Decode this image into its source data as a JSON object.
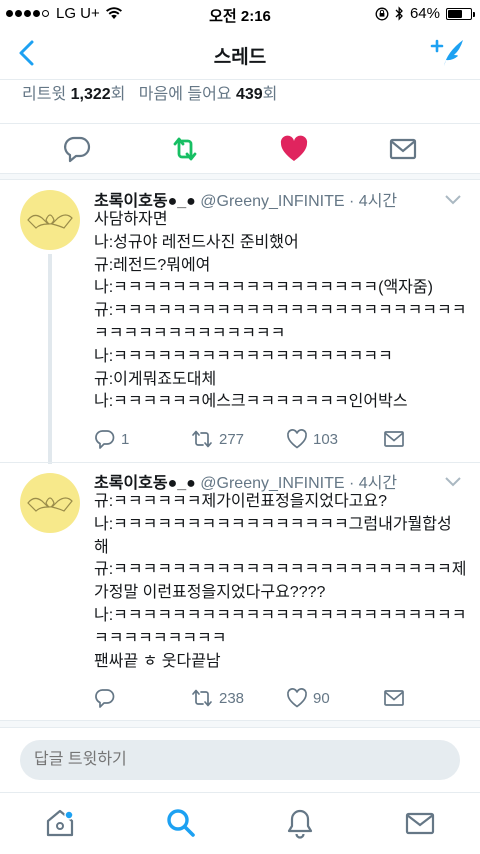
{
  "status_bar": {
    "carrier": "LG U+",
    "time": "오전 2:16",
    "battery": "64%",
    "battery_level": 0.64
  },
  "nav": {
    "title": "스레드"
  },
  "stats": {
    "retweets_label": "리트윗",
    "retweets_count": "1,322",
    "retweets_suffix": "회",
    "likes_label": "마음에 들어요",
    "likes_count": "439",
    "likes_suffix": "회"
  },
  "colors": {
    "accent": "#1da1f2",
    "retweet_green": "#17bf63",
    "like_red": "#e0245e",
    "icon_gray": "#657786"
  },
  "tweets": [
    {
      "name": "초록이호동●_●",
      "handle": "@Greeny_INFINITE",
      "time": "· 4시간",
      "lines": [
        "사담하자면",
        "나:성규야 레전드사진 준비했어",
        "규:레전드?뭐에여",
        "나:ㅋㅋㅋㅋㅋㅋㅋㅋㅋㅋㅋㅋㅋㅋㅋㅋㅋㅋ(액자줌)",
        "규:ㅋㅋㅋㅋㅋㅋㅋㅋㅋㅋㅋㅋㅋㅋㅋㅋㅋㅋㅋㅋㅋㅋㅋㅋ",
        "ㅋㅋㅋㅋㅋㅋㅋㅋㅋㅋㅋㅋㅋ",
        "나:ㅋㅋㅋㅋㅋㅋㅋㅋㅋㅋㅋㅋㅋㅋㅋㅋㅋㅋㅋ",
        "규:이게뭐죠도대체",
        "나:ㅋㅋㅋㅋㅋㅋ에스크ㅋㅋㅋㅋㅋㅋㅋ인어박스"
      ],
      "replies": "1",
      "retweets": "277",
      "likes": "103"
    },
    {
      "name": "초록이호동●_●",
      "handle": "@Greeny_INFINITE",
      "time": "· 4시간",
      "lines": [
        "규:ㅋㅋㅋㅋㅋㅋ제가이런표정을지었다고요?",
        "나:ㅋㅋㅋㅋㅋㅋㅋㅋㅋㅋㅋㅋㅋㅋㅋㅋ그럼내가뭘합성",
        "해",
        "규:ㅋㅋㅋㅋㅋㅋㅋㅋㅋㅋㅋㅋㅋㅋㅋㅋㅋㅋㅋㅋㅋㅋㅋ제",
        "가정말 이런표정을지었다구요????",
        "나:ㅋㅋㅋㅋㅋㅋㅋㅋㅋㅋㅋㅋㅋㅋㅋㅋㅋㅋㅋㅋㅋㅋㅋㅋ",
        "ㅋㅋㅋㅋㅋㅋㅋㅋㅋ",
        "팬싸끝 ㅎ 웃다끝남"
      ],
      "replies": "",
      "retweets": "238",
      "likes": "90"
    }
  ],
  "reply": {
    "placeholder": "답글 트윗하기"
  },
  "tabbar": {
    "items": [
      "home-icon",
      "search-icon",
      "bell-icon",
      "mail-icon"
    ]
  }
}
